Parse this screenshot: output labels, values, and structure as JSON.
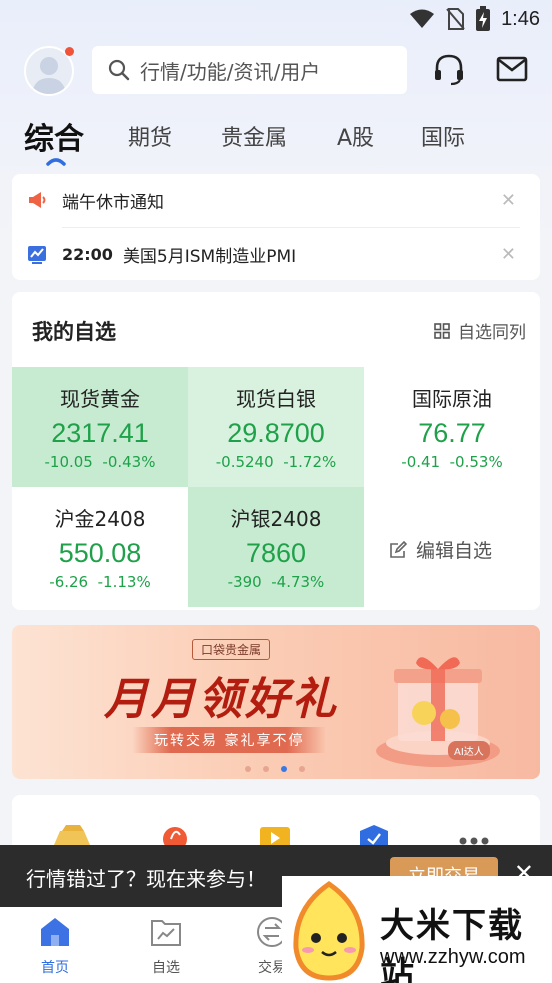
{
  "status": {
    "time": "1:46"
  },
  "search": {
    "placeholder": "行情/功能/资讯/用户"
  },
  "tabs": [
    {
      "label": "综合",
      "active": true
    },
    {
      "label": "期货"
    },
    {
      "label": "贵金属"
    },
    {
      "label": "A股"
    },
    {
      "label": "国际"
    }
  ],
  "notices": [
    {
      "text": "端午休市通知",
      "icon": "megaphone-icon"
    },
    {
      "time": "22:00",
      "text": "美国5月ISM制造业PMI",
      "icon": "chart-icon"
    }
  ],
  "watchlist": {
    "title": "我的自选",
    "same_label": "自选同列",
    "edit_label": "编辑自选",
    "items": [
      {
        "name": "现货黄金",
        "price": "2317.41",
        "change": "-10.05",
        "pct": "-0.43%"
      },
      {
        "name": "现货白银",
        "price": "29.8700",
        "change": "-0.5240",
        "pct": "-1.72%"
      },
      {
        "name": "国际原油",
        "price": "76.77",
        "change": "-0.41",
        "pct": "-0.53%"
      },
      {
        "name": "沪金2408",
        "price": "550.08",
        "change": "-6.26",
        "pct": "-1.13%"
      },
      {
        "name": "沪银2408",
        "price": "7860",
        "change": "-390",
        "pct": "-4.73%"
      }
    ],
    "colors": {
      "down": "#1fa14a",
      "highlight_strong": "#c7ebd1",
      "highlight_light": "#d9f2df"
    }
  },
  "banner": {
    "brand": "口袋贵金属",
    "title": "月月领好礼",
    "subtitle": "玩转交易 豪礼享不停",
    "tag": "AI达人",
    "page_count": 4,
    "active_page": 3
  },
  "toast": {
    "text": "行情错过了？现在来参与！",
    "button": "立即交易"
  },
  "bottom_nav": [
    {
      "label": "首页",
      "active": true
    },
    {
      "label": "自选"
    },
    {
      "label": "交易"
    }
  ],
  "watermark": {
    "title": "大米下载站",
    "url": "www.zzhyw.com"
  },
  "accent": "#2f6de0"
}
